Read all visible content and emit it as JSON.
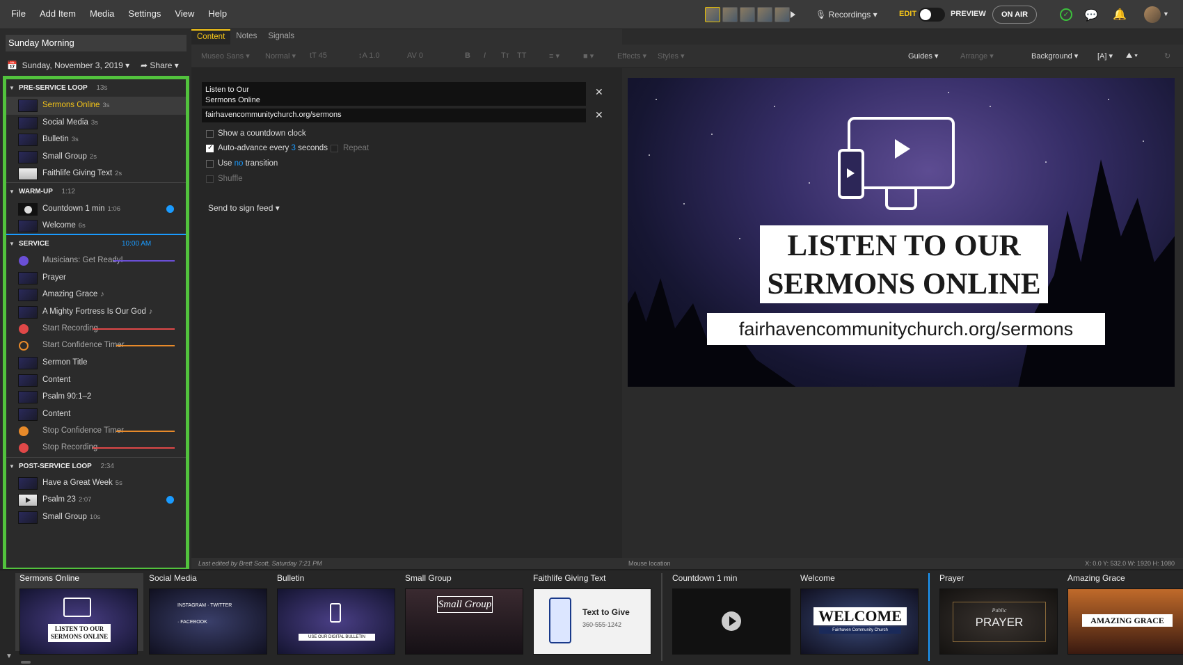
{
  "menu": [
    "File",
    "Add Item",
    "Media",
    "Settings",
    "View",
    "Help"
  ],
  "topbar": {
    "recordings": "Recordings",
    "edit": "EDIT",
    "preview": "PREVIEW",
    "on_air": "ON AIR"
  },
  "plan": {
    "title": "Sunday Morning",
    "date": "Sunday, November 3, 2019",
    "share": "Share"
  },
  "sections": [
    {
      "name": "PRE-SERVICE LOOP",
      "duration": "13s"
    },
    {
      "name": "WARM-UP",
      "duration": "1:12"
    },
    {
      "name": "SERVICE",
      "time": "10:00 AM"
    },
    {
      "name": "POST-SERVICE LOOP",
      "duration": "2:34"
    }
  ],
  "items": {
    "sermons_online": {
      "label": "Sermons Online",
      "dur": "3s"
    },
    "social_media": {
      "label": "Social Media",
      "dur": "3s"
    },
    "bulletin": {
      "label": "Bulletin",
      "dur": "3s"
    },
    "small_group": {
      "label": "Small Group",
      "dur": "2s"
    },
    "faithlife": {
      "label": "Faithlife Giving Text",
      "dur": "2s"
    },
    "countdown": {
      "label": "Countdown 1 min",
      "dur": "1:06"
    },
    "welcome": {
      "label": "Welcome",
      "dur": "6s"
    },
    "musicians": {
      "label": "Musicians: Get Ready!"
    },
    "prayer": {
      "label": "Prayer"
    },
    "amazing_grace": {
      "label": "Amazing Grace"
    },
    "mighty_fortress": {
      "label": "A Mighty Fortress Is Our God"
    },
    "start_recording": {
      "label": "Start Recording"
    },
    "start_conf": {
      "label": "Start Confidence Timer"
    },
    "sermon_title": {
      "label": "Sermon Title"
    },
    "content1": {
      "label": "Content"
    },
    "psalm90": {
      "label": "Psalm 90:1–2"
    },
    "content2": {
      "label": "Content"
    },
    "stop_conf": {
      "label": "Stop Confidence Timer"
    },
    "stop_recording": {
      "label": "Stop Recording"
    },
    "great_week": {
      "label": "Have a Great Week",
      "dur": "5s"
    },
    "psalm23": {
      "label": "Psalm 23",
      "dur": "2:07"
    },
    "small_group2": {
      "label": "Small Group",
      "dur": "10s"
    }
  },
  "editor": {
    "tabs": [
      "Content",
      "Notes",
      "Signals"
    ],
    "format": {
      "font": "Museo Sans",
      "weight": "Normal",
      "size": "45",
      "line": "1.0",
      "spacing": "0",
      "effects": "Effects",
      "styles": "Styles",
      "guides": "Guides",
      "arrange": "Arrange",
      "background": "Background"
    },
    "text1_line1": "Listen to Our",
    "text1_line2": "Sermons Online",
    "text2": "fairhavencommunitychurch.org/sermons",
    "opt_countdown": "Show a  countdown clock",
    "opt_autoadv_a": "Auto-advance every",
    "opt_autoadv_n": "3",
    "opt_autoadv_b": "seconds",
    "opt_repeat": "Repeat",
    "opt_use_a": "Use",
    "opt_use_no": "no",
    "opt_use_b": "transition",
    "opt_shuffle": "Shuffle",
    "send_feed": "Send to sign feed"
  },
  "slide": {
    "title_line1": "LISTEN TO OUR",
    "title_line2": "SERMONS ONLINE",
    "url": "fairhavencommunitychurch.org/sermons"
  },
  "status": {
    "edited": "Last edited by Brett Scott, Saturday 7:21 PM",
    "mouse": "Mouse location",
    "coords": "X: 0.0  Y: 532.0     W: 1920  H: 1080"
  },
  "bottom_cards": [
    {
      "title": "Sermons Online",
      "caption": "LISTEN TO OUR SERMONS ONLINE"
    },
    {
      "title": "Social Media",
      "caption": "INSTAGRAM · TWITTER · FACEBOOK"
    },
    {
      "title": "Bulletin",
      "caption": "USE OUR DIGITAL BULLETIN"
    },
    {
      "title": "Small Group",
      "caption": "Small Group"
    },
    {
      "title": "Faithlife Giving Text",
      "caption": "Text to Give",
      "sub": "360-555-1242"
    },
    {
      "title": "Countdown 1 min"
    },
    {
      "title": "Welcome",
      "caption": "WELCOME",
      "sub": "Fairhaven Community Church"
    },
    {
      "title": "Prayer",
      "caption": "PRAYER",
      "sub": "Public"
    },
    {
      "title": "Amazing Grace",
      "caption": "AMAZING GRACE"
    }
  ]
}
